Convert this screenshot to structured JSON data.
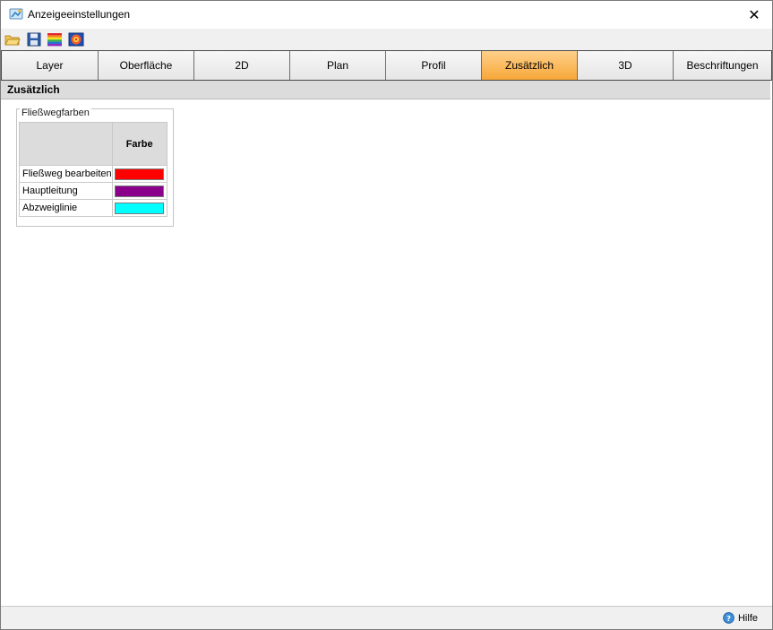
{
  "window": {
    "title": "Anzeigeeinstellungen",
    "close_glyph": "✕"
  },
  "toolbar": {
    "buttons": [
      {
        "name": "open-folder-icon"
      },
      {
        "name": "save-disk-icon"
      },
      {
        "name": "color-stripes-icon"
      },
      {
        "name": "palette-icon"
      }
    ]
  },
  "tabs": [
    {
      "label": "Layer"
    },
    {
      "label": "Oberfläche"
    },
    {
      "label": "2D"
    },
    {
      "label": "Plan"
    },
    {
      "label": "Profil"
    },
    {
      "label": "Zusätzlich",
      "active": true
    },
    {
      "label": "3D"
    },
    {
      "label": "Beschriftungen"
    }
  ],
  "section": {
    "title": "Zusätzlich"
  },
  "group": {
    "legend": "Fließwegfarben",
    "column_header": "Farbe",
    "rows": [
      {
        "label": "Fließweg bearbeiten",
        "color": "#ff0000"
      },
      {
        "label": "Hauptleitung",
        "color": "#8b008b"
      },
      {
        "label": "Abzweiglinie",
        "color": "#00ffff"
      }
    ]
  },
  "status": {
    "help_label": "Hilfe"
  }
}
